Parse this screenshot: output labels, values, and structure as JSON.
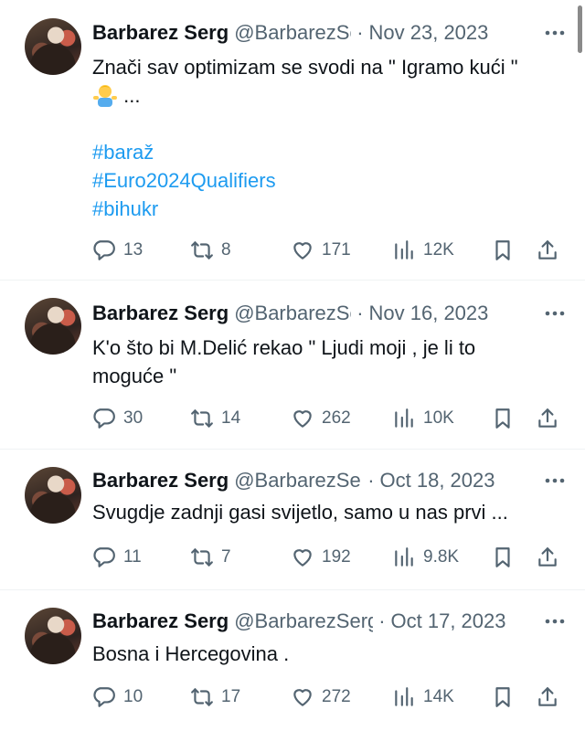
{
  "tweets": [
    {
      "name": "Barbarez Serg",
      "handle": "@BarbarezSer",
      "date": "Nov 23, 2023",
      "text": "Znači sav optimizam se svodi na \" Igramo kući \"",
      "text_suffix": "...",
      "emoji": "person-shrugging-emoji",
      "tags": [
        "#baraž",
        "#Euro2024Qualifiers",
        "#bihukr"
      ],
      "replies": "13",
      "retweets": "8",
      "likes": "171",
      "views": "12K"
    },
    {
      "name": "Barbarez Serg",
      "handle": "@BarbarezSer",
      "date": "Nov 16, 2023",
      "text_line1": "K'o što bi M.Delić rekao \" Ljudi moji , je li  to",
      "text_line2": "moguće \"",
      "replies": "30",
      "retweets": "14",
      "likes": "262",
      "views": "10K"
    },
    {
      "name": "Barbarez Serg",
      "handle": "@BarbarezSer",
      "date": "Oct 18, 2023",
      "text": "Svugdje zadnji gasi svijetlo, samo u nas prvi ...",
      "replies": "11",
      "retweets": "7",
      "likes": "192",
      "views": "9.8K"
    },
    {
      "name": "Barbarez Serg",
      "handle": "@BarbarezSerg",
      "date": "Oct 17, 2023",
      "text": "Bosna i Hercegovina .",
      "replies": "10",
      "retweets": "17",
      "likes": "272",
      "views": "14K"
    }
  ],
  "icons": {
    "reply": "reply-icon",
    "retweet": "retweet-icon",
    "like": "heart-icon",
    "views": "views-icon",
    "bookmark": "bookmark-icon",
    "share": "share-icon",
    "more": "more-icon"
  },
  "colors": {
    "text": "#0f1419",
    "secondary": "#536471",
    "link": "#1d9bf0",
    "divider": "#eff3f4"
  }
}
